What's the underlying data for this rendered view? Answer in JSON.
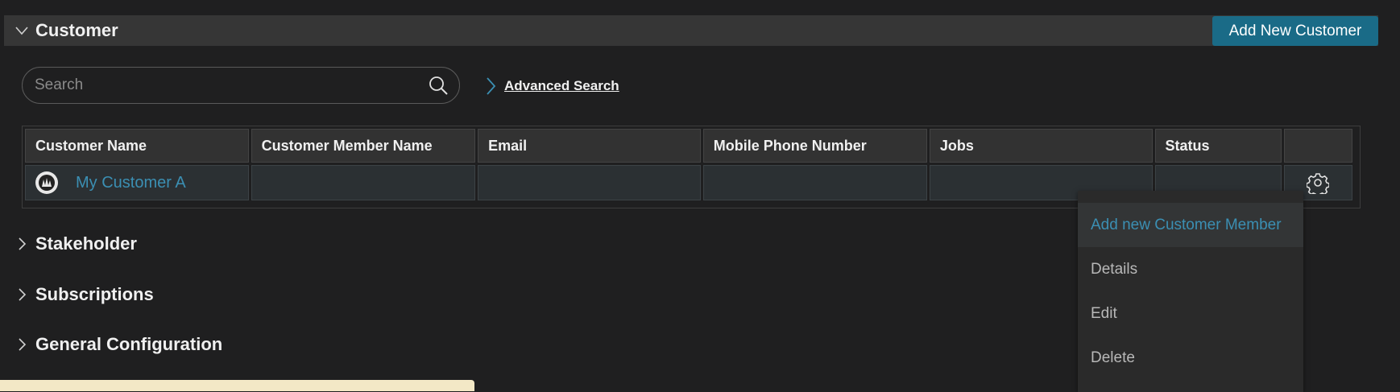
{
  "sections": {
    "customer": {
      "title": "Customer",
      "add_button": "Add New Customer"
    },
    "stakeholder": {
      "title": "Stakeholder"
    },
    "subscriptions": {
      "title": "Subscriptions"
    },
    "general_configuration": {
      "title": "General Configuration"
    }
  },
  "search": {
    "placeholder": "Search",
    "value": ""
  },
  "advanced_search": {
    "label": "Advanced Search"
  },
  "table": {
    "columns": [
      "Customer Name",
      "Customer Member Name",
      "Email",
      "Mobile Phone Number",
      "Jobs",
      "Status",
      ""
    ],
    "rows": [
      {
        "customer_name": "My Customer A",
        "member_name": "",
        "email": "",
        "mobile": "",
        "jobs": "",
        "status": ""
      }
    ]
  },
  "context_menu": {
    "items": [
      "Add new Customer Member",
      "Details",
      "Edit",
      "Delete"
    ],
    "highlighted": "Add new Customer Member"
  },
  "colors": {
    "accent": "#1a6b87",
    "link": "#3b8fb3",
    "background": "#1f1f20"
  },
  "icons": [
    "chevron-down-icon",
    "chevron-right-icon",
    "search-icon",
    "gear-icon",
    "avatar-icon"
  ]
}
